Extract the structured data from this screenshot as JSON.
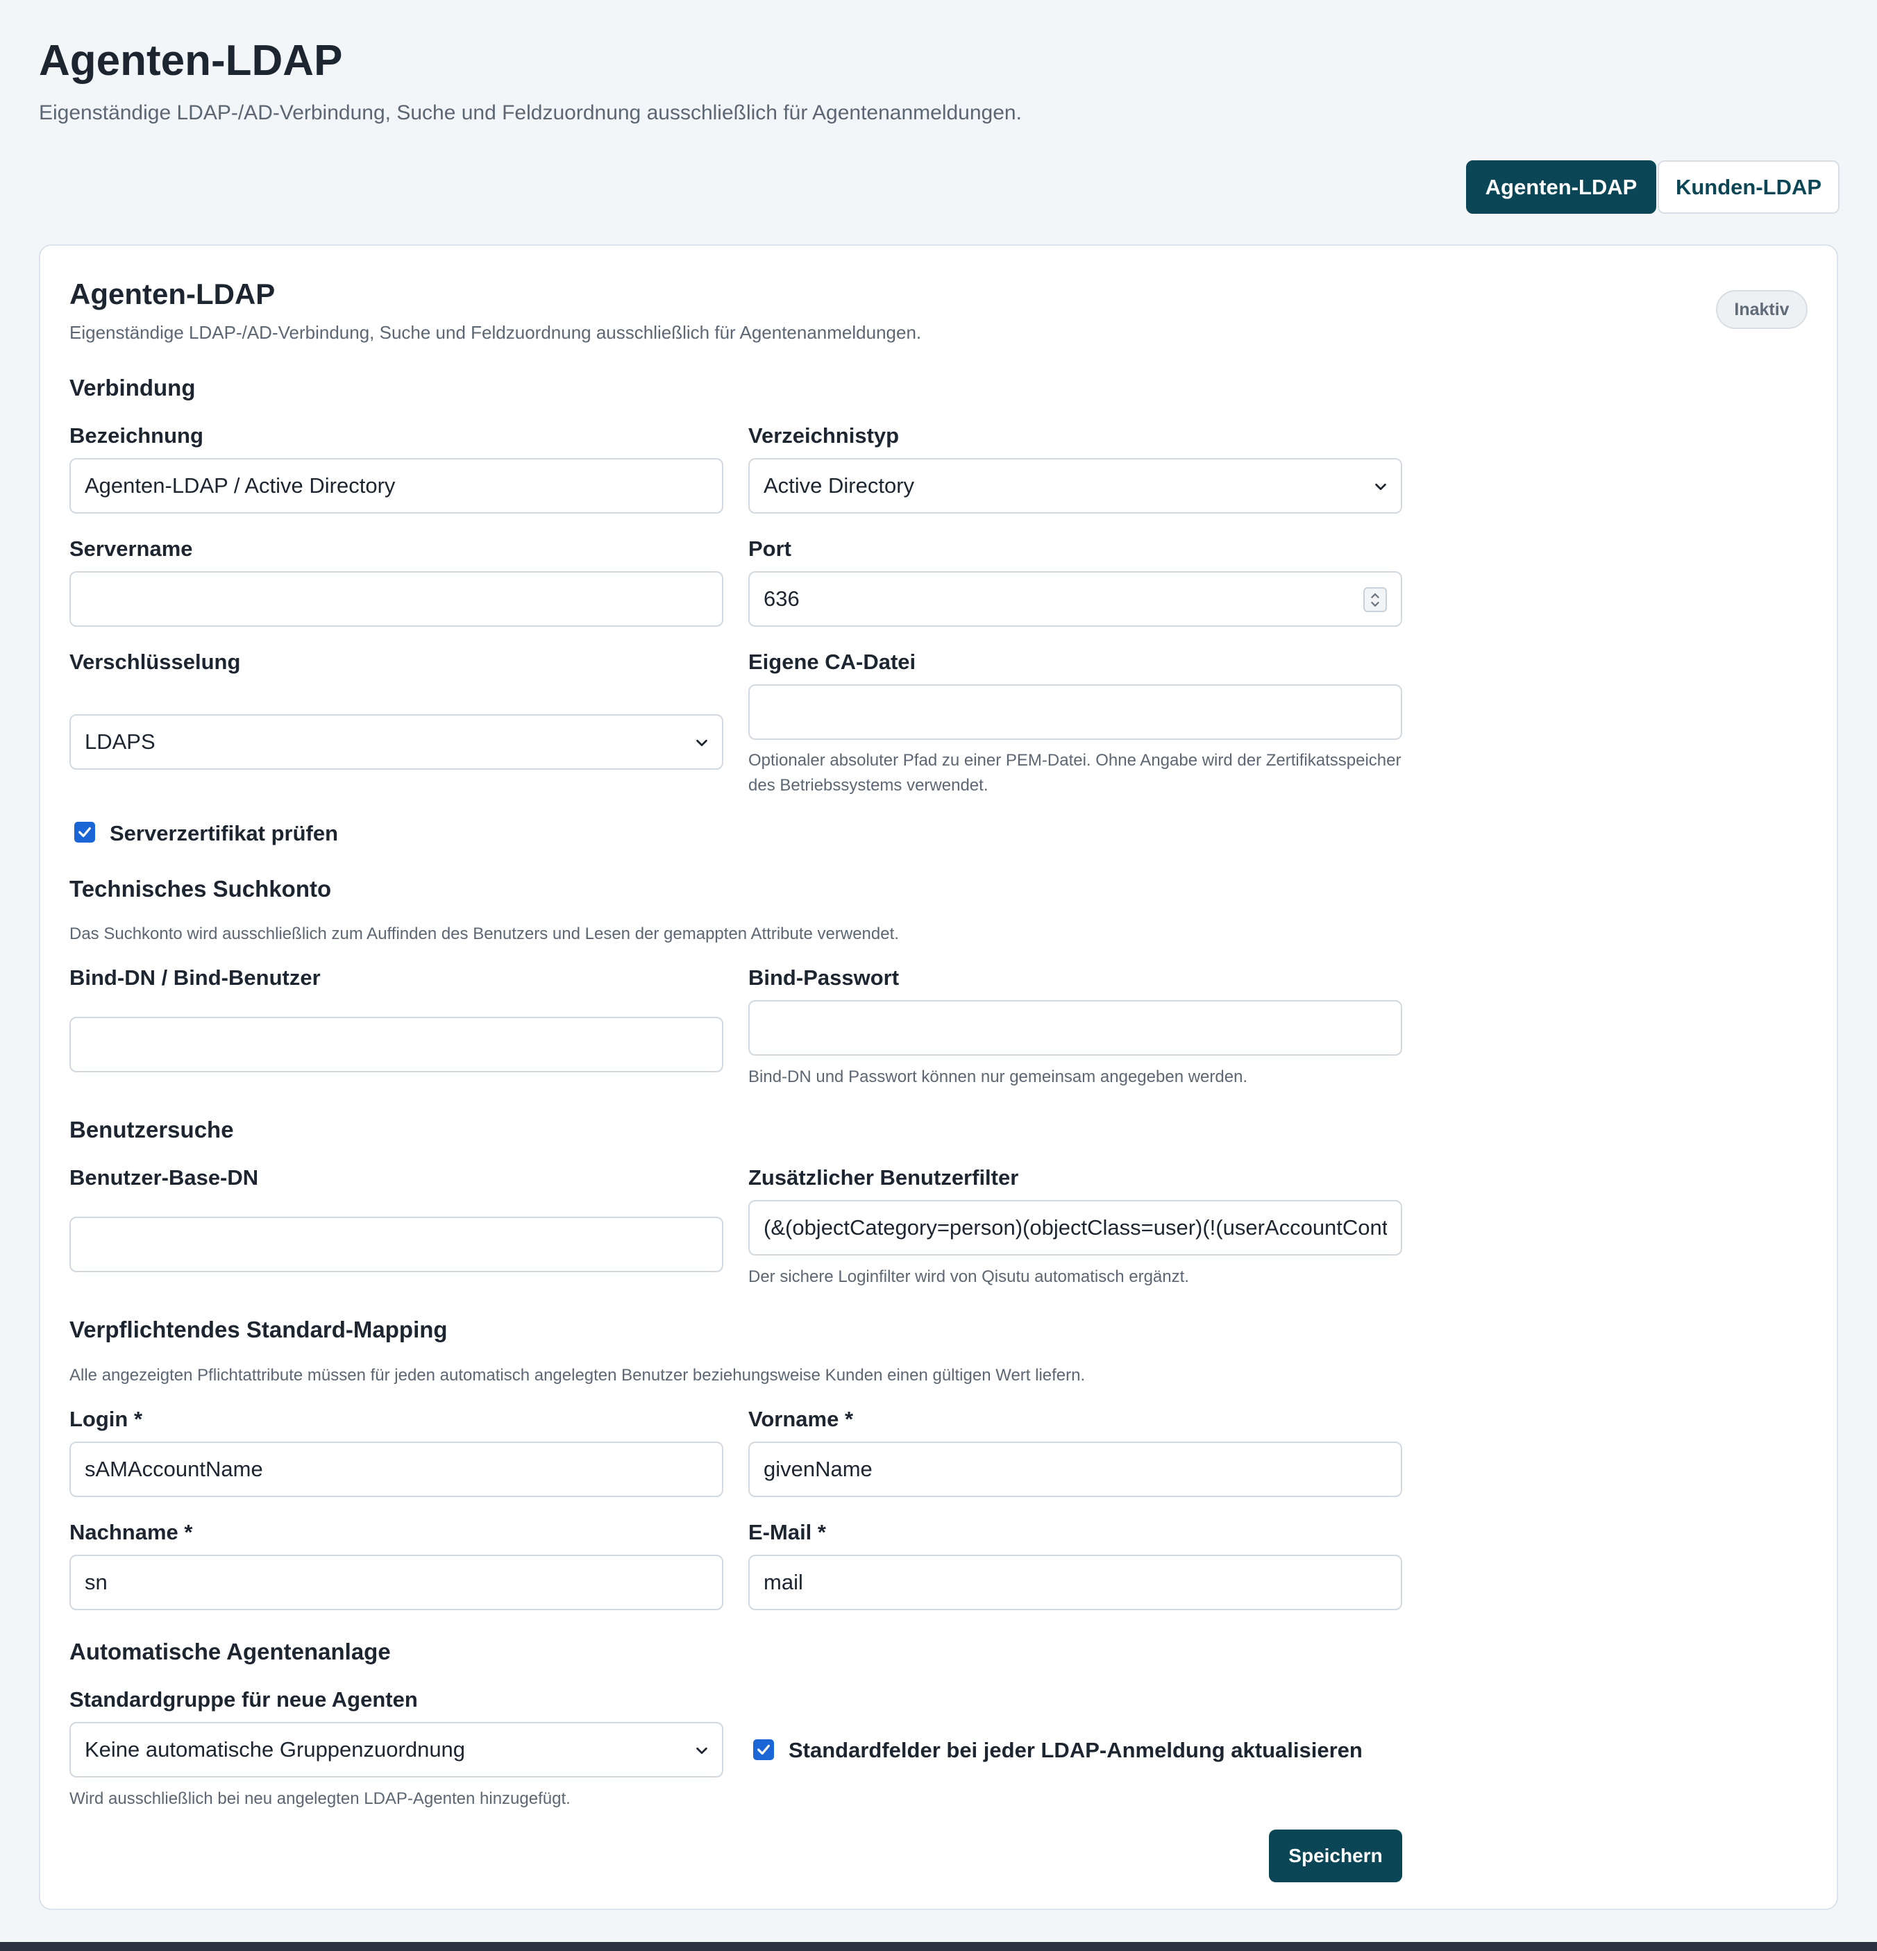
{
  "page": {
    "title": "Agenten-LDAP",
    "subtitle": "Eigenständige LDAP-/AD-Verbindung, Suche und Feldzuordnung ausschließlich für Agentenanmeldungen."
  },
  "tabs": [
    {
      "label": "Agenten-LDAP",
      "active": true
    },
    {
      "label": "Kunden-LDAP",
      "active": false
    }
  ],
  "card": {
    "title": "Agenten-LDAP",
    "subtitle": "Eigenständige LDAP-/AD-Verbindung, Suche und Feldzuordnung ausschließlich für Agentenanmeldungen.",
    "status_badge": "Inaktiv"
  },
  "connection": {
    "section_title": "Verbindung",
    "name_label": "Bezeichnung",
    "name_value": "Agenten-LDAP / Active Directory",
    "directory_type_label": "Verzeichnistyp",
    "directory_type_value": "Active Directory",
    "server_label": "Servername",
    "server_value": "",
    "port_label": "Port",
    "port_value": "636",
    "encryption_label": "Verschlüsselung",
    "encryption_value": "LDAPS",
    "ca_file_label": "Eigene CA-Datei",
    "ca_file_value": "",
    "ca_file_hint_line1": "Optionaler absoluter Pfad zu einer PEM-Datei. Ohne Angabe wird der Zertifikatsspeicher",
    "ca_file_hint_line2": "des Betriebssystems verwendet.",
    "verify_cert_label": "Serverzertifikat prüfen",
    "verify_cert_checked": true
  },
  "search_account": {
    "section_title": "Technisches Suchkonto",
    "hint": "Das Suchkonto wird ausschließlich zum Auffinden des Benutzers und Lesen der gemappten Attribute verwendet.",
    "bind_dn_label": "Bind-DN / Bind-Benutzer",
    "bind_dn_value": "",
    "bind_password_label": "Bind-Passwort",
    "bind_password_value": "",
    "bind_password_hint": "Bind-DN und Passwort können nur gemeinsam angegeben werden."
  },
  "user_search": {
    "section_title": "Benutzersuche",
    "base_dn_label": "Benutzer-Base-DN",
    "base_dn_value": "",
    "filter_label": "Zusätzlicher Benutzerfilter",
    "filter_value": "(&(objectCategory=person)(objectClass=user)(!(userAccountContro",
    "filter_hint": "Der sichere Loginfilter wird von Qisutu automatisch ergänzt."
  },
  "mapping": {
    "section_title": "Verpflichtendes Standard-Mapping",
    "hint": "Alle angezeigten Pflichtattribute müssen für jeden automatisch angelegten Benutzer beziehungsweise Kunden einen gültigen Wert liefern.",
    "login_label": "Login *",
    "login_value": "sAMAccountName",
    "firstname_label": "Vorname *",
    "firstname_value": "givenName",
    "lastname_label": "Nachname *",
    "lastname_value": "sn",
    "email_label": "E-Mail *",
    "email_value": "mail"
  },
  "auto_create": {
    "section_title": "Automatische Agentenanlage",
    "group_label": "Standardgruppe für neue Agenten",
    "group_value": "Keine automatische Gruppenzuordnung",
    "group_hint": "Wird ausschließlich bei neu angelegten LDAP-Agenten hinzugefügt.",
    "update_fields_label": "Standardfelder bei jeder LDAP-Anmeldung aktualisieren",
    "update_fields_checked": true
  },
  "actions": {
    "save_label": "Speichern"
  },
  "colors": {
    "primary": "#0b4656",
    "checkbox": "#1a66d6",
    "background": "#f3f6f9"
  },
  "icons": {
    "select_arrow": "chevron-down-icon",
    "checkbox": "check-icon",
    "port_stepper": "spinner-icon"
  }
}
